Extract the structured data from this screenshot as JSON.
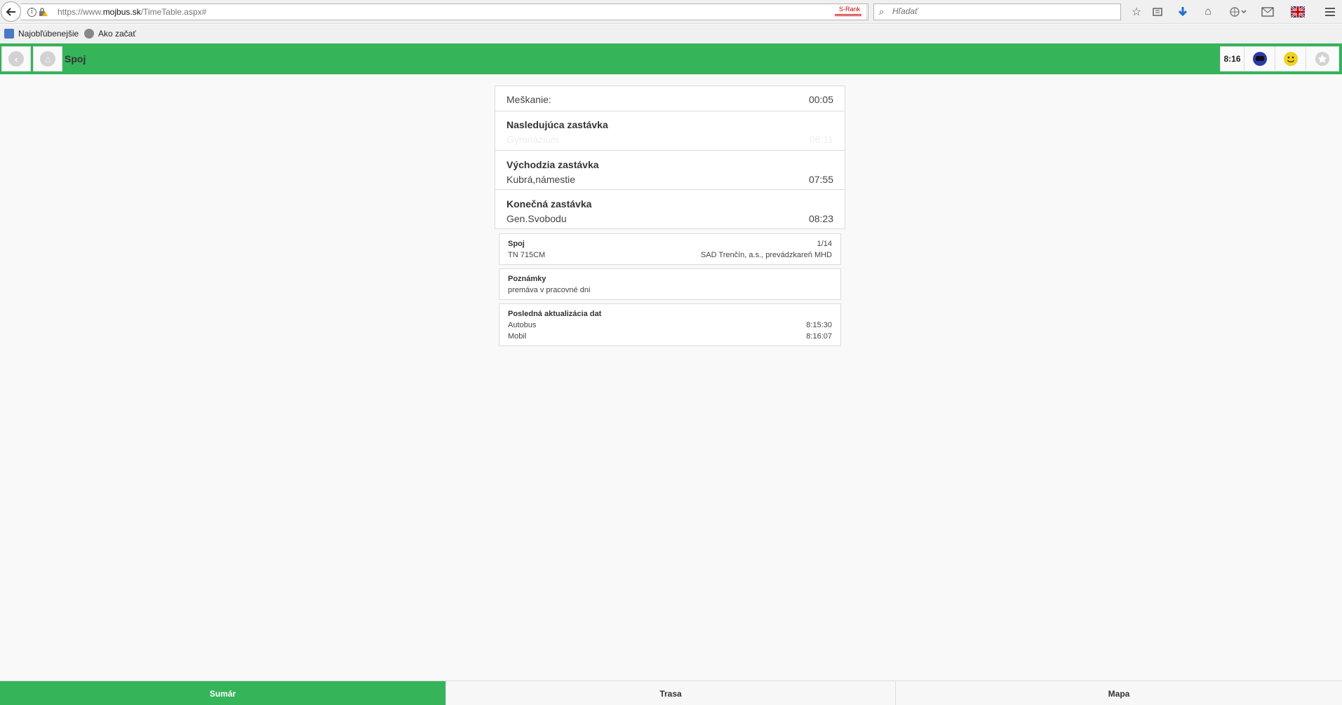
{
  "browser": {
    "url_prefix": "https://www.",
    "url_domain": "mojbus.sk",
    "url_path": "/TimeTable.aspx#",
    "srank_label": "S-Rank",
    "search_placeholder": "Hľadať",
    "icons": [
      "back-icon",
      "info-icon",
      "lock-warning-icon",
      "reload-icon",
      "search-icon",
      "star-icon",
      "reading-list-icon",
      "download-icon",
      "home-icon",
      "globe-icon",
      "mail-icon",
      "uk-flag-icon",
      "menu-icon"
    ]
  },
  "bookmarks": {
    "items": [
      {
        "label": "Najobľúbenejšie",
        "icon": "bookmark-icon"
      },
      {
        "label": "Ako začať",
        "icon": "globe-icon"
      }
    ]
  },
  "header": {
    "title": "Spoj",
    "time": "8:16",
    "back_icon": "back-arrow-icon",
    "home_icon": "home-icon",
    "chat_icon": "chat-icon",
    "smiley_icon": "smiley-icon",
    "favorite_icon": "star-icon",
    "accent_color": "#35b45a"
  },
  "trip": {
    "delay_label": "Meškanie:",
    "delay_value": "00:05",
    "next_stop_label": "Nasledujúca zastávka",
    "next_stop_name": "Gymnázium",
    "next_stop_time": "08:11",
    "start_stop_label": "Východzia zastávka",
    "start_stop_name": "Kubrá,námestie",
    "start_stop_time": "07:55",
    "end_stop_label": "Konečná zastávka",
    "end_stop_name": "Gen.Svobodu",
    "end_stop_time": "08:23"
  },
  "connection": {
    "title": "Spoj",
    "index": "1/14",
    "code": "TN 715CM",
    "operator": "SAD Trenčín, a.s., prevádzkareň MHD"
  },
  "notes": {
    "title": "Poznámky",
    "text": "premáva v pracovné dni"
  },
  "update": {
    "title": "Posledná aktualizácia dat",
    "bus_label": "Autobus",
    "bus_time": "8:15:30",
    "mobile_label": "Mobil",
    "mobile_time": "8:16:07"
  },
  "tabs": [
    {
      "label": "Sumár",
      "active": true
    },
    {
      "label": "Trasa",
      "active": false
    },
    {
      "label": "Mapa",
      "active": false
    }
  ]
}
